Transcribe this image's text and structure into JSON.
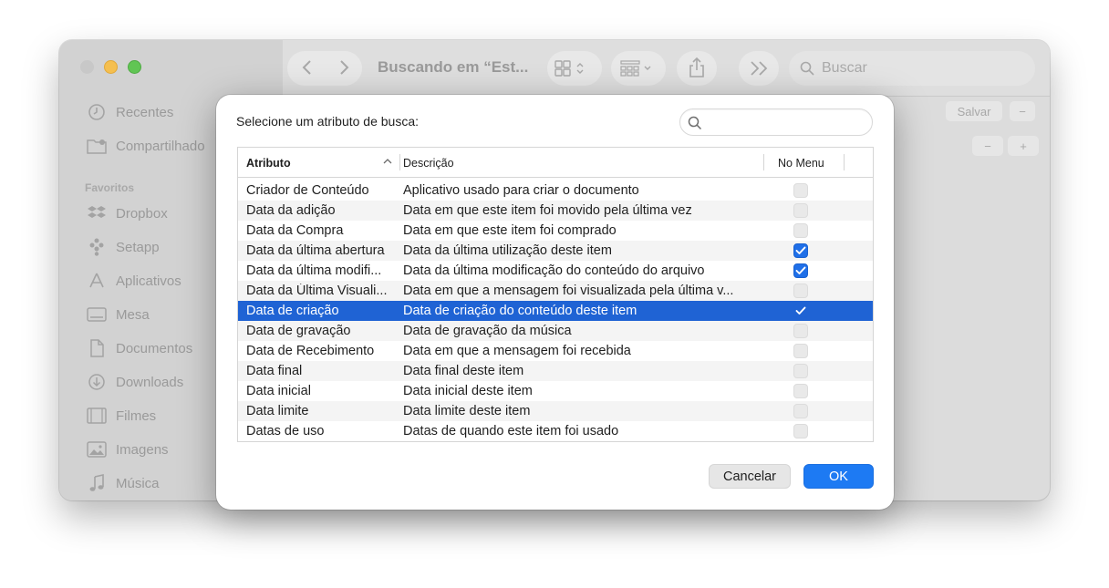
{
  "finder": {
    "title": "Buscando em “Est...",
    "search_placeholder": "Buscar",
    "save_label": "Salvar",
    "minus_label": "−",
    "plus_label": "+",
    "sidebar": {
      "top_items": [
        {
          "label": "Recentes",
          "icon": "clock-icon"
        },
        {
          "label": "Compartilhado",
          "icon": "shared-folder-icon"
        }
      ],
      "favorites_header": "Favoritos",
      "favorites": [
        {
          "label": "Dropbox",
          "icon": "dropbox-icon"
        },
        {
          "label": "Setapp",
          "icon": "setapp-icon"
        },
        {
          "label": "Aplicativos",
          "icon": "applications-icon"
        },
        {
          "label": "Mesa",
          "icon": "desktop-icon"
        },
        {
          "label": "Documentos",
          "icon": "document-icon"
        },
        {
          "label": "Downloads",
          "icon": "download-icon"
        },
        {
          "label": "Filmes",
          "icon": "film-icon"
        },
        {
          "label": "Imagens",
          "icon": "image-icon"
        },
        {
          "label": "Música",
          "icon": "music-icon"
        }
      ]
    }
  },
  "dialog": {
    "label": "Selecione um atributo de busca:",
    "search_value": "",
    "columns": {
      "attribute": "Atributo",
      "description": "Descrição",
      "in_menu": "No Menu"
    },
    "rows": [
      {
        "attr": "Criador de Conteúdo",
        "desc": "Aplicativo usado para criar o documento",
        "checked": false,
        "selected": false
      },
      {
        "attr": "Data da adição",
        "desc": "Data em que este item foi movido pela última vez",
        "checked": false,
        "selected": false
      },
      {
        "attr": "Data da Compra",
        "desc": "Data em que este item foi comprado",
        "checked": false,
        "selected": false
      },
      {
        "attr": "Data da última abertura",
        "desc": "Data da última utilização deste item",
        "checked": true,
        "selected": false
      },
      {
        "attr": "Data da última modifi...",
        "desc": "Data da última modificação do conteúdo do arquivo",
        "checked": true,
        "selected": false
      },
      {
        "attr": "Data da Última Visuali...",
        "desc": "Data em que a mensagem foi visualizada pela última v...",
        "checked": false,
        "selected": false
      },
      {
        "attr": "Data de criação",
        "desc": "Data de criação do conteúdo deste item",
        "checked": true,
        "selected": true
      },
      {
        "attr": "Data de gravação",
        "desc": "Data de gravação da música",
        "checked": false,
        "selected": false
      },
      {
        "attr": "Data de Recebimento",
        "desc": "Data em que a mensagem foi recebida",
        "checked": false,
        "selected": false
      },
      {
        "attr": "Data final",
        "desc": "Data final deste item",
        "checked": false,
        "selected": false
      },
      {
        "attr": "Data inicial",
        "desc": "Data inicial deste item",
        "checked": false,
        "selected": false
      },
      {
        "attr": "Data limite",
        "desc": "Data limite deste item",
        "checked": false,
        "selected": false
      },
      {
        "attr": "Datas de uso",
        "desc": "Datas de quando este item foi usado",
        "checked": false,
        "selected": false
      }
    ],
    "cancel_label": "Cancelar",
    "ok_label": "OK"
  },
  "colors": {
    "selection": "#1f63d4",
    "accent": "#1d7af3",
    "checkbox_on": "#1f6fe8"
  }
}
